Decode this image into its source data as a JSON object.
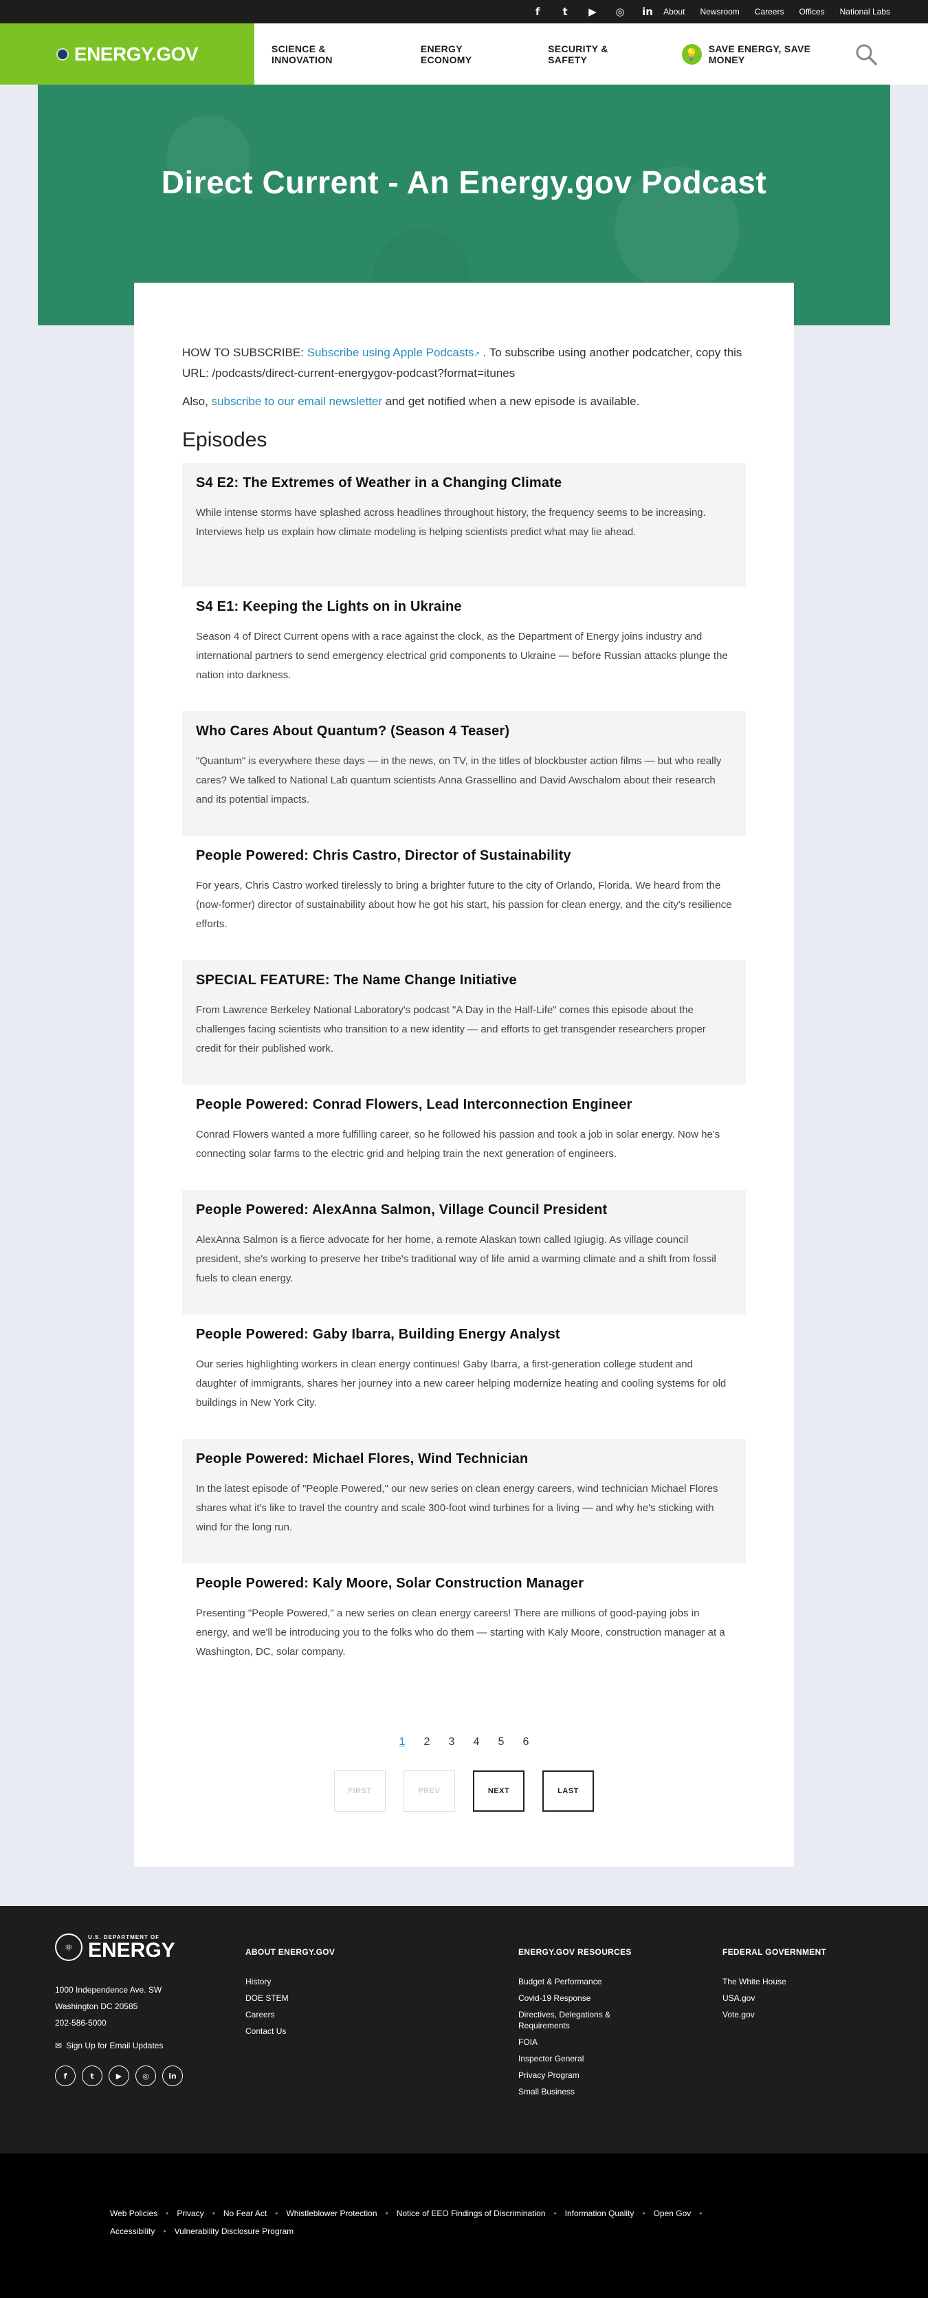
{
  "utility": {
    "social": [
      {
        "icon": "facebook-icon",
        "glyph": "f"
      },
      {
        "icon": "twitter-icon",
        "glyph": "t"
      },
      {
        "icon": "youtube-icon",
        "glyph": "▶"
      },
      {
        "icon": "instagram-icon",
        "glyph": "◎"
      },
      {
        "icon": "linkedin-icon",
        "glyph": "in"
      }
    ],
    "links": [
      "About",
      "Newsroom",
      "Careers",
      "Offices",
      "National Labs"
    ]
  },
  "header": {
    "brand": "ENERGY.GOV",
    "nav": [
      "SCIENCE & INNOVATION",
      "ENERGY ECONOMY",
      "SECURITY & SAFETY"
    ],
    "save_energy": "SAVE ENERGY, SAVE MONEY"
  },
  "hero": {
    "title": "Direct Current - An Energy.gov Podcast"
  },
  "intro": {
    "subscribe_prefix": "HOW TO SUBSCRIBE: ",
    "subscribe_link": "Subscribe using Apple Podcasts",
    "subscribe_suffix": " . To subscribe using another podcatcher, copy this URL: /podcasts/direct-current-energygov-podcast?format=itunes",
    "newsletter_prefix": "Also, ",
    "newsletter_link": "subscribe to our email newsletter",
    "newsletter_suffix": " and get notified when a new episode is available."
  },
  "episodes_heading": "Episodes",
  "episodes": [
    {
      "title": "S4 E2: The Extremes of Weather in a Changing Climate",
      "summary": "While intense storms have splashed across headlines throughout history, the frequency seems to be increasing. Interviews help us explain how climate modeling is helping scientists predict what may lie ahead."
    },
    {
      "title": "S4 E1: Keeping the Lights on in Ukraine",
      "summary": "Season 4 of Direct Current opens with a race against the clock, as the Department of Energy joins industry and international partners to send emergency electrical grid components to Ukraine — before Russian attacks plunge the nation into darkness."
    },
    {
      "title": "Who Cares About Quantum? (Season 4 Teaser)",
      "summary": "\"Quantum\" is everywhere these days — in the news, on TV, in the titles of blockbuster action films — but who really cares? We talked to National Lab quantum scientists Anna Grassellino and David Awschalom about their research and its potential impacts."
    },
    {
      "title": "People Powered: Chris Castro, Director of Sustainability",
      "summary": "For years, Chris Castro worked tirelessly to bring a brighter future to the city of Orlando, Florida. We heard from the (now-former) director of sustainability about how he got his start, his passion for clean energy, and the city's resilience efforts."
    },
    {
      "title": "SPECIAL FEATURE: The Name Change Initiative",
      "summary": "From Lawrence Berkeley National Laboratory's podcast \"A Day in the Half-Life\" comes this episode about the challenges facing scientists who transition to a new identity — and efforts to get transgender researchers proper credit for their published work."
    },
    {
      "title": "People Powered: Conrad Flowers, Lead Interconnection Engineer",
      "summary": "Conrad Flowers wanted a more fulfilling career, so he followed his passion and took a job in solar energy. Now he's connecting solar farms to the electric grid and helping train the next generation of engineers."
    },
    {
      "title": "People Powered: AlexAnna Salmon, Village Council President",
      "summary": "AlexAnna Salmon is a fierce advocate for her home, a remote Alaskan town called Igiugig. As village council president, she's working to preserve her tribe's traditional way of life amid a warming climate and a shift from fossil fuels to clean energy."
    },
    {
      "title": "People Powered: Gaby Ibarra, Building Energy Analyst",
      "summary": "Our series highlighting workers in clean energy continues! Gaby Ibarra, a first-generation college student and daughter of immigrants, shares her journey into a new career helping modernize heating and cooling systems for old buildings in New York City."
    },
    {
      "title": "People Powered: Michael Flores, Wind Technician",
      "summary": "In the latest episode of \"People Powered,\" our new series on clean energy careers, wind technician Michael Flores shares what it's like to travel the country and scale 300-foot wind turbines for a living — and why he's sticking with wind for the long run."
    },
    {
      "title": "People Powered: Kaly Moore, Solar Construction Manager",
      "summary": "Presenting \"People Powered,\" a new series on clean energy careers! There are millions of good-paying jobs in energy, and we'll be introducing you to the folks who do them — starting with Kaly Moore, construction manager at a Washington, DC, solar company."
    }
  ],
  "pager": {
    "pages": [
      "1",
      "2",
      "3",
      "4",
      "5",
      "6"
    ],
    "current": "1",
    "first": "FIRST",
    "prev": "PREV",
    "next": "NEXT",
    "last": "LAST"
  },
  "footer": {
    "logo_top": "U.S. DEPARTMENT OF",
    "logo_big": "ENERGY",
    "address": [
      "1000 Independence Ave. SW",
      "Washington DC 20585",
      "202-586-5000"
    ],
    "signup": "Sign Up for Email Updates",
    "social": [
      {
        "icon": "facebook-icon",
        "glyph": "f"
      },
      {
        "icon": "twitter-icon",
        "glyph": "t"
      },
      {
        "icon": "youtube-icon",
        "glyph": "▶"
      },
      {
        "icon": "instagram-icon",
        "glyph": "◎"
      },
      {
        "icon": "linkedin-icon",
        "glyph": "in"
      }
    ],
    "about_heading": "ABOUT ENERGY.GOV",
    "about_links": [
      "History",
      "DOE STEM",
      "Careers",
      "Contact Us"
    ],
    "resources_heading": "ENERGY.GOV RESOURCES",
    "resources_links": [
      "Budget & Performance",
      "Covid-19 Response",
      "Directives, Delegations & Requirements",
      "FOIA",
      "Inspector General",
      "Privacy Program",
      "Small Business"
    ],
    "federal_heading": "FEDERAL GOVERNMENT",
    "federal_links": [
      "The White House",
      "USA.gov",
      "Vote.gov"
    ]
  },
  "bottom_links": [
    "Web Policies",
    "Privacy",
    "No Fear Act",
    "Whistleblower Protection",
    "Notice of EEO Findings of Discrimination",
    "Information Quality",
    "Open Gov",
    "Accessibility",
    "Vulnerability Disclosure Program"
  ],
  "colors": {
    "brand_green": "#7bc324",
    "hero_green": "#2b8a65",
    "link_blue": "#2a8eb8",
    "footer_bg": "#1d1d1d"
  }
}
